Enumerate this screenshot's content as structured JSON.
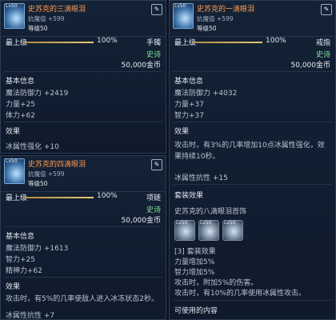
{
  "panel_a": {
    "item_name": "史苏克的三滴眼泪",
    "stat": "抗魔值 +599",
    "grade": "等级50",
    "lv": "Lv50",
    "max_level_label": "最上级",
    "max_level_percent": "100%",
    "progress": 1.0,
    "type": "手镯",
    "rarity": "史诗",
    "price": "50,000金币",
    "basic_info_title": "基本信息",
    "stats": [
      "魔法防御力 +2419",
      "力量+25",
      "体力+62"
    ],
    "effect_title": "效果",
    "effect_lines": [
      "冰属性强化 +10"
    ]
  },
  "panel_b": {
    "item_name": "史苏克的一滴眼泪",
    "stat": "抗魔值 +599",
    "grade": "等级50",
    "lv": "Lv50",
    "max_level_label": "最上级",
    "max_level_percent": "100%",
    "progress": 1.0,
    "type": "戒指",
    "rarity": "史诗",
    "price": "50,000金币",
    "basic_info_title": "基本信息",
    "stats": [
      "魔法防御力 +4032",
      "力量+37",
      "智力+37"
    ],
    "effect_title": "效果",
    "effect_desc": "攻击时，有3%的几率增加10点冰属性强化，效果持续10秒。",
    "effect_extra": "冰属性抗性 +15",
    "set_title": "套装效果",
    "set_name": "史苏克的八滴眼泪首饰",
    "set_slots": [
      "Lv50",
      "Lv50",
      "Lv50"
    ],
    "set_lines": [
      "[3] 套装效果",
      "力量增加5%",
      "智力增加5%",
      "攻击时，附加5%的伤害。",
      "攻击时，有10%的几率使用冰属性攻击。"
    ],
    "usable_title": "可使用的内容"
  },
  "panel_c": {
    "item_name": "史苏克的四滴眼泪",
    "stat": "抗魔值 +599",
    "grade": "等级50",
    "lv": "Lv50",
    "max_level_label": "最上级",
    "max_level_percent": "100%",
    "progress": 1.0,
    "type": "项链",
    "rarity": "史诗",
    "price": "50,000金币",
    "basic_info_title": "基本信息",
    "stats": [
      "魔法防御力 +1613",
      "智力+25",
      "精神力+62"
    ],
    "effect_title": "效果",
    "effect_desc": "攻击时，有5%的几率使敌人进入冰冻状态2秒。",
    "effect_extra": "冰属性抗性 +7"
  },
  "colors": {
    "accent": "#ff9b52",
    "rarity": "#7fe29a",
    "progress": "#e7c774"
  },
  "icons": {
    "item": "frost-tear-icon",
    "corner": "compare-icon"
  }
}
